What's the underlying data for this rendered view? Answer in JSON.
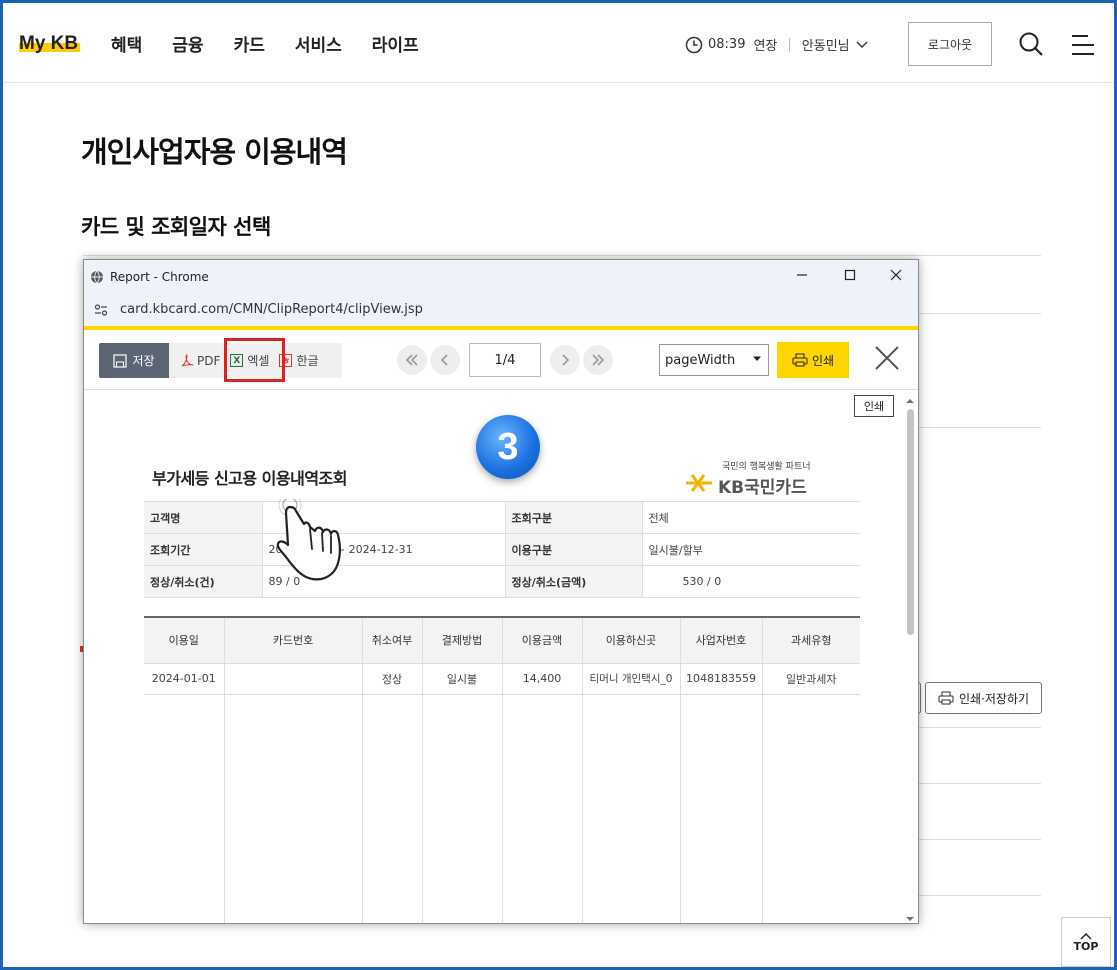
{
  "header": {
    "logo": "My KB",
    "nav": [
      "혜택",
      "금융",
      "카드",
      "서비스",
      "라이프"
    ],
    "time": "08:39",
    "extend_label": "연장",
    "user_name": "안동민님",
    "logout_label": "로그아웃"
  },
  "page": {
    "title": "개인사업자용 이용내역",
    "section_title": "카드 및 조회일자 선택",
    "print_save_label": "인쇄·저장하기",
    "top_label": "TOP"
  },
  "popup": {
    "window_title": "Report - Chrome",
    "url": "card.kbcard.com/CMN/ClipReport4/clipView.jsp",
    "toolbar": {
      "save_label": "저장",
      "pdf_label": "PDF",
      "excel_label": "엑셀",
      "hwp_label": "한글",
      "page_indicator": "1/4",
      "zoom_value": "pageWidth",
      "print_label": "인쇄"
    },
    "print_tooltip": "인쇄",
    "step_number": "3",
    "report": {
      "title": "부가세등 신고용 이용내역조회",
      "brand_tagline": "국민의 행복생활 파트너",
      "brand_name": "KB국민카드",
      "summary": [
        {
          "k1": "고객명",
          "v1": "",
          "k2": "조회구분",
          "v2": "전체"
        },
        {
          "k1": "조회기간",
          "v1": "2024-01-01 ~ 2024-12-31",
          "k2": "이용구분",
          "v2": "일시불/할부"
        },
        {
          "k1": "정상/취소(건)",
          "v1": "89 / 0",
          "k2": "정상/취소(금액)",
          "v2": "530 / 0"
        }
      ],
      "columns": [
        "이용일",
        "카드번호",
        "취소여부",
        "결제방법",
        "이용금액",
        "이용하신곳",
        "사업자번호",
        "과세유형"
      ],
      "rows": [
        [
          "2024-01-01",
          "",
          "정상",
          "일시불",
          "14,400",
          "티머니 개인택시_0",
          "1048183559",
          "일반과세자"
        ]
      ]
    }
  },
  "colors": {
    "accent_yellow": "#ffd600",
    "frame_blue": "#1a66b5",
    "highlight_red": "#e02020"
  }
}
